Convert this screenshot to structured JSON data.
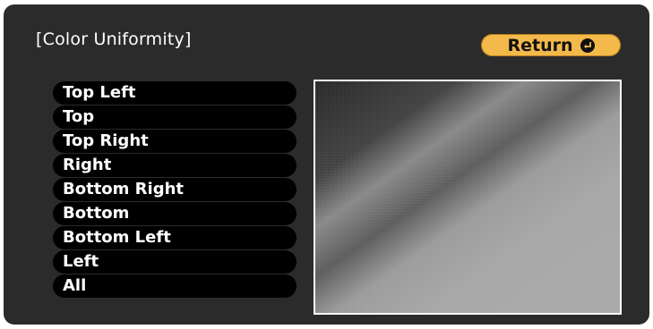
{
  "title": "[Color Uniformity]",
  "return_button": {
    "label": "Return",
    "icon": "enter-icon"
  },
  "menu": {
    "items": [
      {
        "label": "Top Left"
      },
      {
        "label": "Top"
      },
      {
        "label": "Top Right"
      },
      {
        "label": "Right"
      },
      {
        "label": "Bottom Right"
      },
      {
        "label": "Bottom"
      },
      {
        "label": "Bottom Left"
      },
      {
        "label": "Left"
      },
      {
        "label": "All"
      }
    ]
  },
  "colors": {
    "panel": "#2b2b2b",
    "menu_item": "#000000",
    "accent": "#f3b94a"
  }
}
